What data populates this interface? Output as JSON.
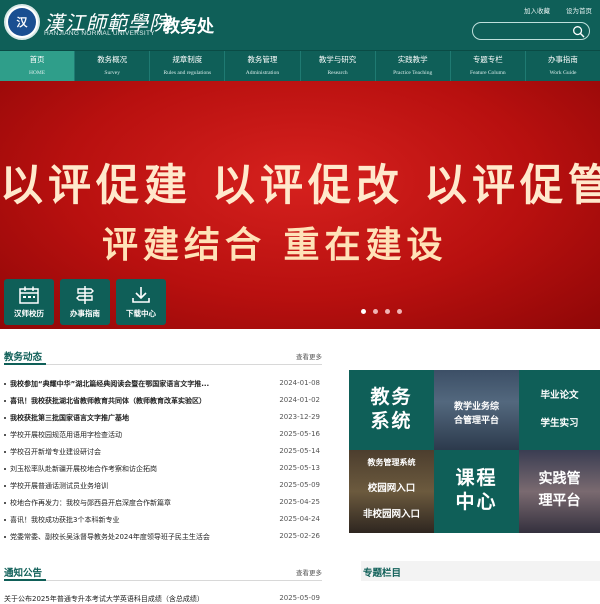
{
  "header": {
    "school_name": "漢江師範學院",
    "school_name_en": "HANJIANG NORMAL UNIVERSITY",
    "site_title": "教务处",
    "logo_text": "汉",
    "top_links": [
      "加入收藏",
      "设为首页"
    ],
    "search_placeholder": ""
  },
  "nav": [
    {
      "zh": "首页",
      "en": "HOME"
    },
    {
      "zh": "教务概况",
      "en": "Survey"
    },
    {
      "zh": "规章制度",
      "en": "Rules and regulations"
    },
    {
      "zh": "教务管理",
      "en": "Administration"
    },
    {
      "zh": "教学与研究",
      "en": "Research"
    },
    {
      "zh": "实践教学",
      "en": "Practice Teaching"
    },
    {
      "zh": "专题专栏",
      "en": "Feature Column"
    },
    {
      "zh": "办事指南",
      "en": "Work Guide"
    }
  ],
  "banner": {
    "line1": "以评促建 以评促改 以评促管",
    "line2": "评建结合 重在建设",
    "quick_links": [
      "汉师校历",
      "办事指南",
      "下载中心"
    ],
    "slide_count": 4,
    "active_slide": 1
  },
  "news_section": {
    "title": "教务动态",
    "more": "查看更多",
    "items": [
      {
        "title": "我校参加“典耀中华”湖北篇经典阅读会暨在鄂国家语言文字推...",
        "date": "2024-01-08",
        "bold": true
      },
      {
        "title": "喜讯！我校获批湖北省教师教育共同体（教师教育改革实验区）",
        "date": "2024-01-02",
        "bold": true
      },
      {
        "title": "我校获批第三批国家语言文字推广基地",
        "date": "2023-12-29",
        "bold": true
      },
      {
        "title": "学校开展校园规范用语用字检查活动",
        "date": "2025-05-16",
        "bold": false
      },
      {
        "title": "学校召开新增专业建设研讨会",
        "date": "2025-05-14",
        "bold": false
      },
      {
        "title": "刘玉松率队赴新疆开展校地合作考察和访企拓岗",
        "date": "2025-05-13",
        "bold": false
      },
      {
        "title": "学校开展普通话测试员业务培训",
        "date": "2025-05-09",
        "bold": false
      },
      {
        "title": "校地合作再发力：我校与郧西县开启深度合作新篇章",
        "date": "2025-04-25",
        "bold": false
      },
      {
        "title": "喜讯！我校成功获批3个本科新专业",
        "date": "2025-04-24",
        "bold": false
      },
      {
        "title": "党委常委、副校长吴泳督导教务处2024年度领导班子民主生活会",
        "date": "2025-02-26",
        "bold": false
      }
    ]
  },
  "tiles": {
    "jwxt": [
      "教务",
      "系统"
    ],
    "jxyw": [
      "教学业务综",
      "合管理平台"
    ],
    "lunwen": [
      "毕业论文",
      "学生实习"
    ],
    "guanli": [
      "教务管理系统",
      "校园网入口",
      "非校园网入口"
    ],
    "kecheng": [
      "课程",
      "中心"
    ],
    "shijian": [
      "实践管",
      "理平台"
    ]
  },
  "notice_section": {
    "title": "通知公告",
    "more": "查看更多",
    "first_item_title": "关于公布2025年普通专升本考试大学英语科目成绩（含总成绩）",
    "first_item_date": "2025-05-09"
  },
  "feature_section": {
    "title": "专题栏目"
  },
  "colors": {
    "brand": "#0f5f58",
    "banner_red": "#c8161a",
    "nav_active": "#2f9e8a"
  }
}
